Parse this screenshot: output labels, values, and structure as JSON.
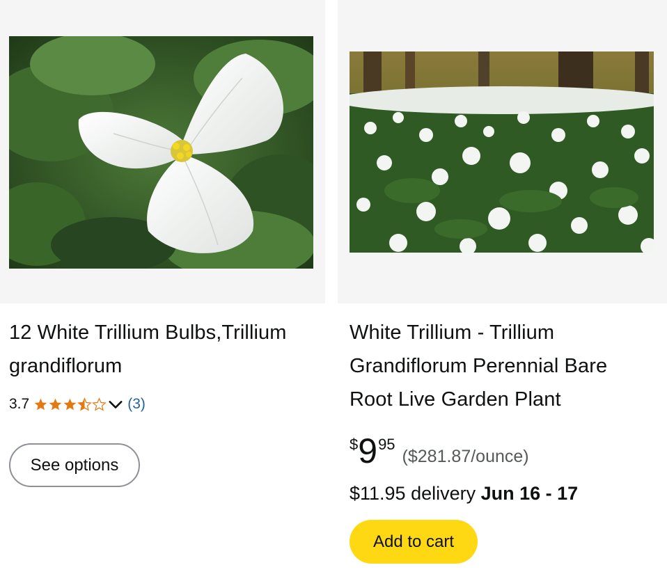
{
  "products": [
    {
      "title": "12 White Trillium Bulbs,Trillium grandiflorum",
      "rating": "3.7",
      "stars_value": 3.5,
      "review_count": "(3)",
      "button_label": "See options"
    },
    {
      "title": "White Trillium - Trillium Grandiflorum Perennial Bare Root Live Garden Plant",
      "price_symbol": "$",
      "price_whole": "9",
      "price_fraction": "95",
      "unit_price": "($281.87/ounce)",
      "delivery_prefix": "$11.95 delivery",
      "delivery_date": "Jun 16 - 17",
      "button_label": "Add to cart"
    }
  ],
  "colors": {
    "star": "#e47911",
    "link": "#2162a1",
    "cart_button": "#ffd814"
  }
}
